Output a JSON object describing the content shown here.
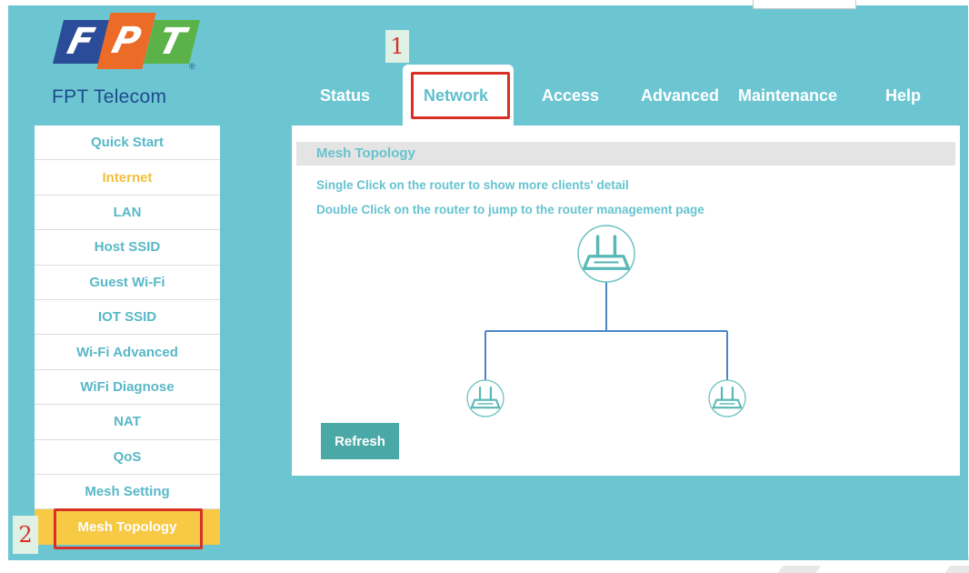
{
  "brand": {
    "logo_letters": [
      "F",
      "P",
      "T"
    ],
    "logo_colors": [
      "#2a4c99",
      "#ec6b26",
      "#5bb248"
    ],
    "name": "FPT Telecom"
  },
  "annotations": {
    "step1": "1",
    "step2": "2"
  },
  "tabs": [
    {
      "label": "Status"
    },
    {
      "label": "Network",
      "active": true
    },
    {
      "label": "Access"
    },
    {
      "label": "Advanced"
    },
    {
      "label": "Maintenance"
    },
    {
      "label": "Help"
    }
  ],
  "sidebar": {
    "items": [
      {
        "label": "Quick Start"
      },
      {
        "label": "Internet"
      },
      {
        "label": "LAN"
      },
      {
        "label": "Host SSID"
      },
      {
        "label": "Guest Wi-Fi"
      },
      {
        "label": "IOT SSID"
      },
      {
        "label": "Wi-Fi Advanced"
      },
      {
        "label": "WiFi Diagnose"
      },
      {
        "label": "NAT"
      },
      {
        "label": "QoS"
      },
      {
        "label": "Mesh Setting"
      },
      {
        "label": "Mesh Topology",
        "active": true
      }
    ]
  },
  "main": {
    "section_title": "Mesh Topology",
    "instructions": [
      "Single Click on the router to show more clients' detail",
      "Double Click on the router to jump to the router management page"
    ],
    "topology": {
      "nodes": [
        {
          "role": "main-router",
          "icon": "router-icon"
        },
        {
          "role": "satellite",
          "icon": "router-icon"
        },
        {
          "role": "satellite",
          "icon": "router-icon"
        }
      ]
    },
    "refresh_label": "Refresh"
  },
  "colors": {
    "background": "#6cc6d2",
    "accent_text": "#66c3cf",
    "active_item": "#f7c945",
    "highlight_border": "#d93025",
    "button": "#4aa8a6"
  }
}
